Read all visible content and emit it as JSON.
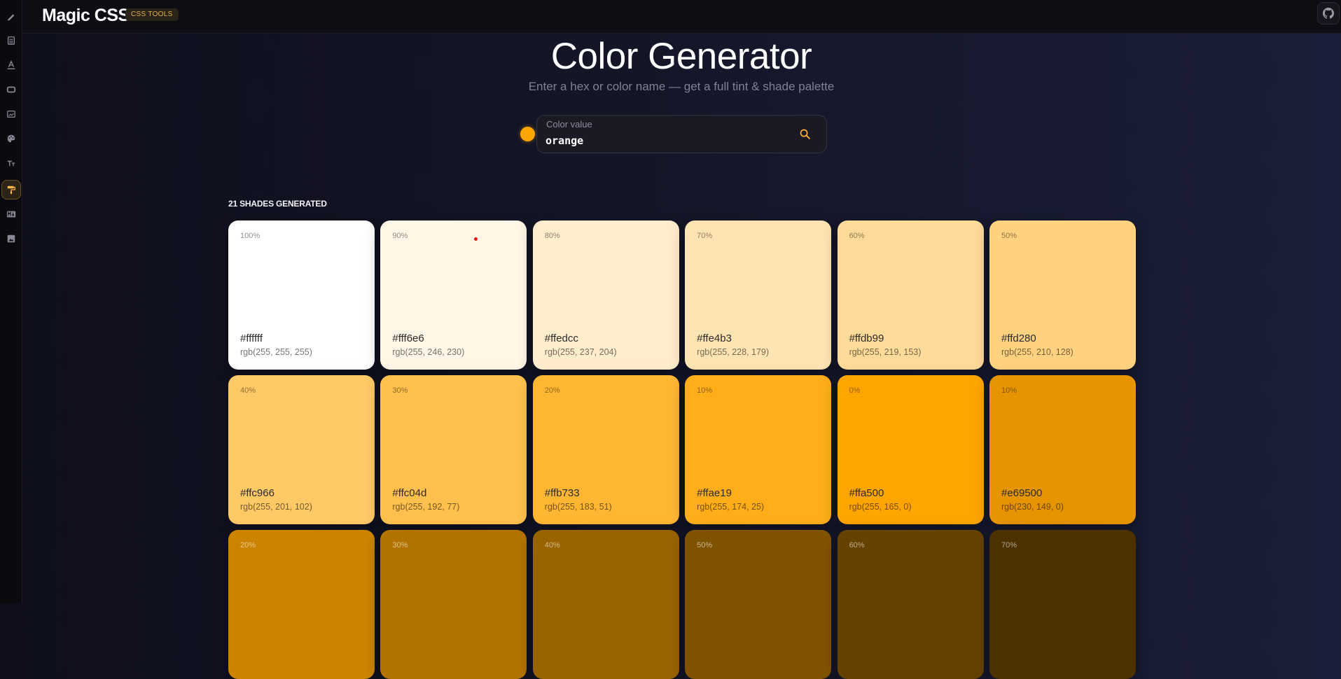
{
  "app": {
    "name": "Magic CSS",
    "badge": "CSS TOOLS"
  },
  "sidebar": {
    "items": [
      {
        "icon": "pen-icon"
      },
      {
        "icon": "calculator-icon"
      },
      {
        "icon": "text-underline-icon"
      },
      {
        "icon": "rectangle-icon"
      },
      {
        "icon": "image-frame-icon"
      },
      {
        "icon": "palette-icon"
      },
      {
        "icon": "font-size-icon"
      },
      {
        "icon": "paint-roller-icon",
        "active": true
      },
      {
        "icon": "markdown-icon"
      },
      {
        "icon": "image-icon"
      }
    ]
  },
  "header": {
    "github_icon": "github-icon"
  },
  "page": {
    "title": "Color Generator",
    "subtitle": "Enter a hex or color name — get a full tint & shade palette"
  },
  "search": {
    "label": "Color value",
    "value": "orange",
    "preview_color": "#ffa500"
  },
  "results": {
    "count_label": "21 SHADES GENERATED",
    "shades": [
      {
        "pct": "100%",
        "hex": "#ffffff",
        "rgb": "rgb(255, 255, 255)",
        "color": "#ffffff",
        "tone": "light"
      },
      {
        "pct": "90%",
        "hex": "#fff6e6",
        "rgb": "rgb(255, 246, 230)",
        "color": "#fff6e6",
        "tone": "light"
      },
      {
        "pct": "80%",
        "hex": "#ffedcc",
        "rgb": "rgb(255, 237, 204)",
        "color": "#ffedcc",
        "tone": "light"
      },
      {
        "pct": "70%",
        "hex": "#ffe4b3",
        "rgb": "rgb(255, 228, 179)",
        "color": "#ffe4b3",
        "tone": "light"
      },
      {
        "pct": "60%",
        "hex": "#ffdb99",
        "rgb": "rgb(255, 219, 153)",
        "color": "#ffdb99",
        "tone": "light"
      },
      {
        "pct": "50%",
        "hex": "#ffd280",
        "rgb": "rgb(255, 210, 128)",
        "color": "#ffd280",
        "tone": "light"
      },
      {
        "pct": "40%",
        "hex": "#ffc966",
        "rgb": "rgb(255, 201, 102)",
        "color": "#ffc966",
        "tone": "light"
      },
      {
        "pct": "30%",
        "hex": "#ffc04d",
        "rgb": "rgb(255, 192, 77)",
        "color": "#ffc04d",
        "tone": "light"
      },
      {
        "pct": "20%",
        "hex": "#ffb733",
        "rgb": "rgb(255, 183, 51)",
        "color": "#ffb733",
        "tone": "light"
      },
      {
        "pct": "10%",
        "hex": "#ffae19",
        "rgb": "rgb(255, 174, 25)",
        "color": "#ffae19",
        "tone": "light"
      },
      {
        "pct": "0%",
        "hex": "#ffa500",
        "rgb": "rgb(255, 165, 0)",
        "color": "#ffa500",
        "tone": "light"
      },
      {
        "pct": "10%",
        "hex": "#e69500",
        "rgb": "rgb(230, 149, 0)",
        "color": "#e69500",
        "tone": "light"
      },
      {
        "pct": "20%",
        "hex": "",
        "rgb": "",
        "color": "#cc8400",
        "tone": "dark"
      },
      {
        "pct": "30%",
        "hex": "",
        "rgb": "",
        "color": "#b37300",
        "tone": "dark"
      },
      {
        "pct": "40%",
        "hex": "",
        "rgb": "",
        "color": "#996300",
        "tone": "dark"
      },
      {
        "pct": "50%",
        "hex": "",
        "rgb": "",
        "color": "#805300",
        "tone": "dark"
      },
      {
        "pct": "60%",
        "hex": "",
        "rgb": "",
        "color": "#664200",
        "tone": "dark"
      },
      {
        "pct": "70%",
        "hex": "",
        "rgb": "",
        "color": "#4d3200",
        "tone": "dark"
      }
    ]
  }
}
